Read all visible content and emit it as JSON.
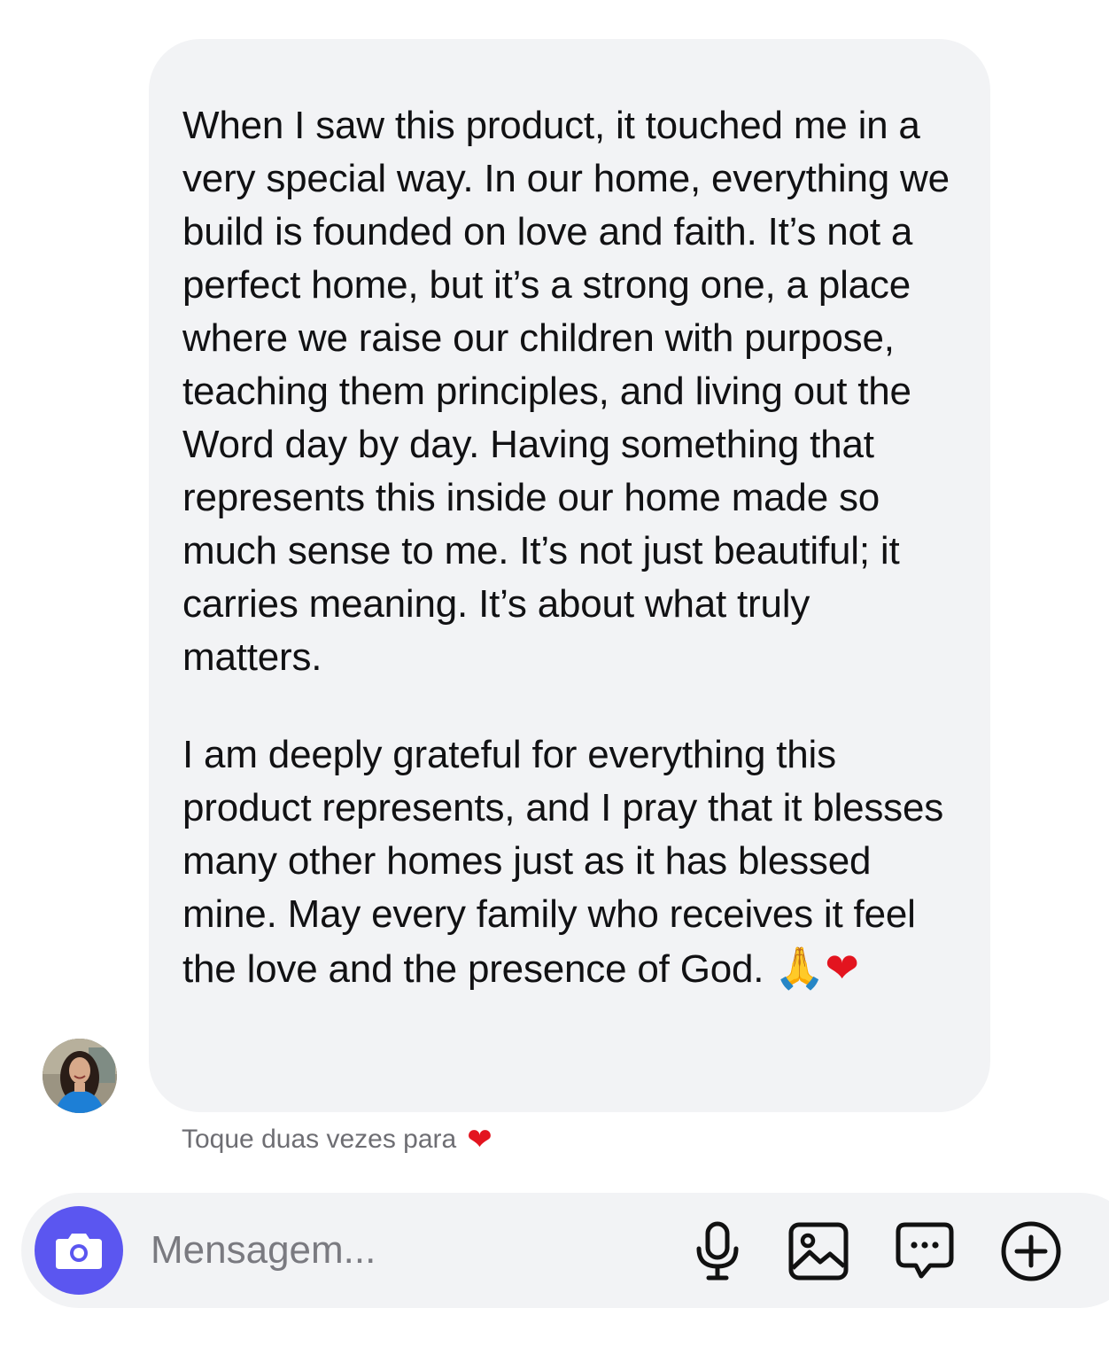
{
  "message": {
    "paragraphs": [
      "When I saw this product, it touched me in a very special way. In our home, everything we build is founded on love and faith. It’s not a perfect home, but it’s a strong one, a place where we raise our children with purpose, teaching them principles, and living out the Word day by day. Having something that represents this inside our home made so much sense to me. It’s not just beautiful; it carries meaning. It’s about what truly matters.",
      "I am deeply grateful for everything this product represents, and I pray that it blesses many other homes just as it has blessed mine. May every family who receives it feel the love and the presence of God."
    ],
    "emojis": [
      "🙏",
      "❤"
    ]
  },
  "hint": {
    "text": "Toque duas vezes para",
    "emoji": "❤"
  },
  "composer": {
    "placeholder": "Mensagem...",
    "icons": [
      "camera-icon",
      "microphone-icon",
      "image-icon",
      "chat-bubble-icon",
      "plus-circle-icon"
    ],
    "camera_button_color": "#5b56f0"
  },
  "colors": {
    "bubble_background": "#f2f3f5",
    "text": "#111113",
    "secondary_text": "#6e6e73",
    "heart": "#e3141f"
  }
}
